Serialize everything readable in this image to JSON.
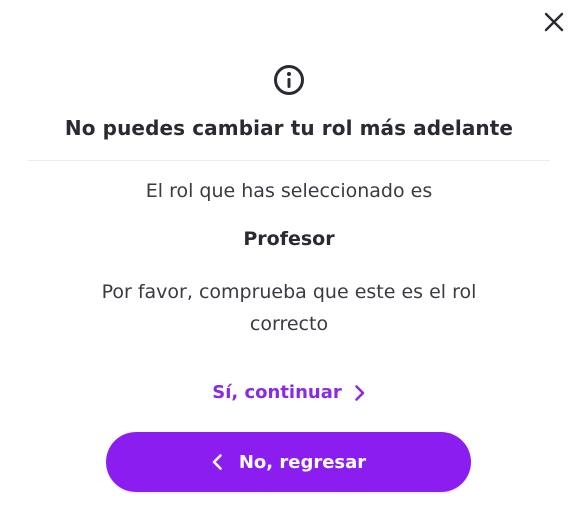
{
  "dialog": {
    "close_icon": "close-icon",
    "info_icon": "info-icon",
    "title": "No puedes cambiar tu rol más adelante",
    "selected_label": "El rol que has seleccionado es",
    "role": "Profesor",
    "confirm_message": "Por favor, comprueba que este es el rol correcto",
    "continue_label": "Sí, continuar",
    "back_label": "No, regresar"
  },
  "colors": {
    "accent": "#8c1df0",
    "link": "#8a2be2",
    "text": "#2a2a33"
  }
}
